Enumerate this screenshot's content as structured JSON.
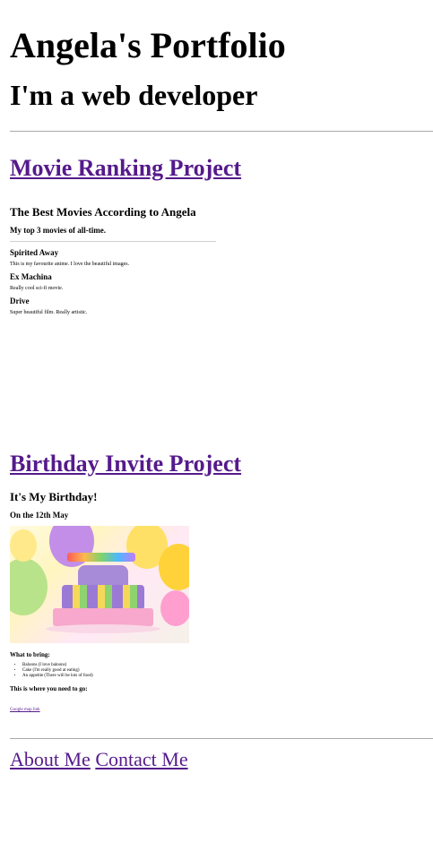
{
  "header": {
    "title": "Angela's Portfolio",
    "subtitle": "I'm a web developer"
  },
  "projects": [
    {
      "link": "Movie Ranking Project",
      "preview": {
        "title": "The Best Movies According to Angela",
        "subtitle": "My top 3 movies of all-time.",
        "movies": [
          {
            "name": "Spirited Away",
            "desc": "This is my favourite anime. I love the beautiful images."
          },
          {
            "name": "Ex Machina",
            "desc": "Really cool sci-fi movie."
          },
          {
            "name": "Drive",
            "desc": "Super beautiful film. Really artistic."
          }
        ]
      }
    },
    {
      "link": "Birthday Invite Project",
      "preview": {
        "title": "It's My Birthday!",
        "date": "On the 12th May",
        "bring_heading": "What to bring:",
        "bring_items": [
          "Baloons (I love baloons)",
          "Cake (I'm really good at eating)",
          "An appetite (There will be lots of food)"
        ],
        "where_heading": "This is where you need to go:",
        "map_link": "Google map link"
      }
    }
  ],
  "footer": {
    "about": "About Me",
    "contact": "Contact Me"
  },
  "colors": {
    "link": "#551a8b",
    "rule": "#a9a9a9"
  }
}
